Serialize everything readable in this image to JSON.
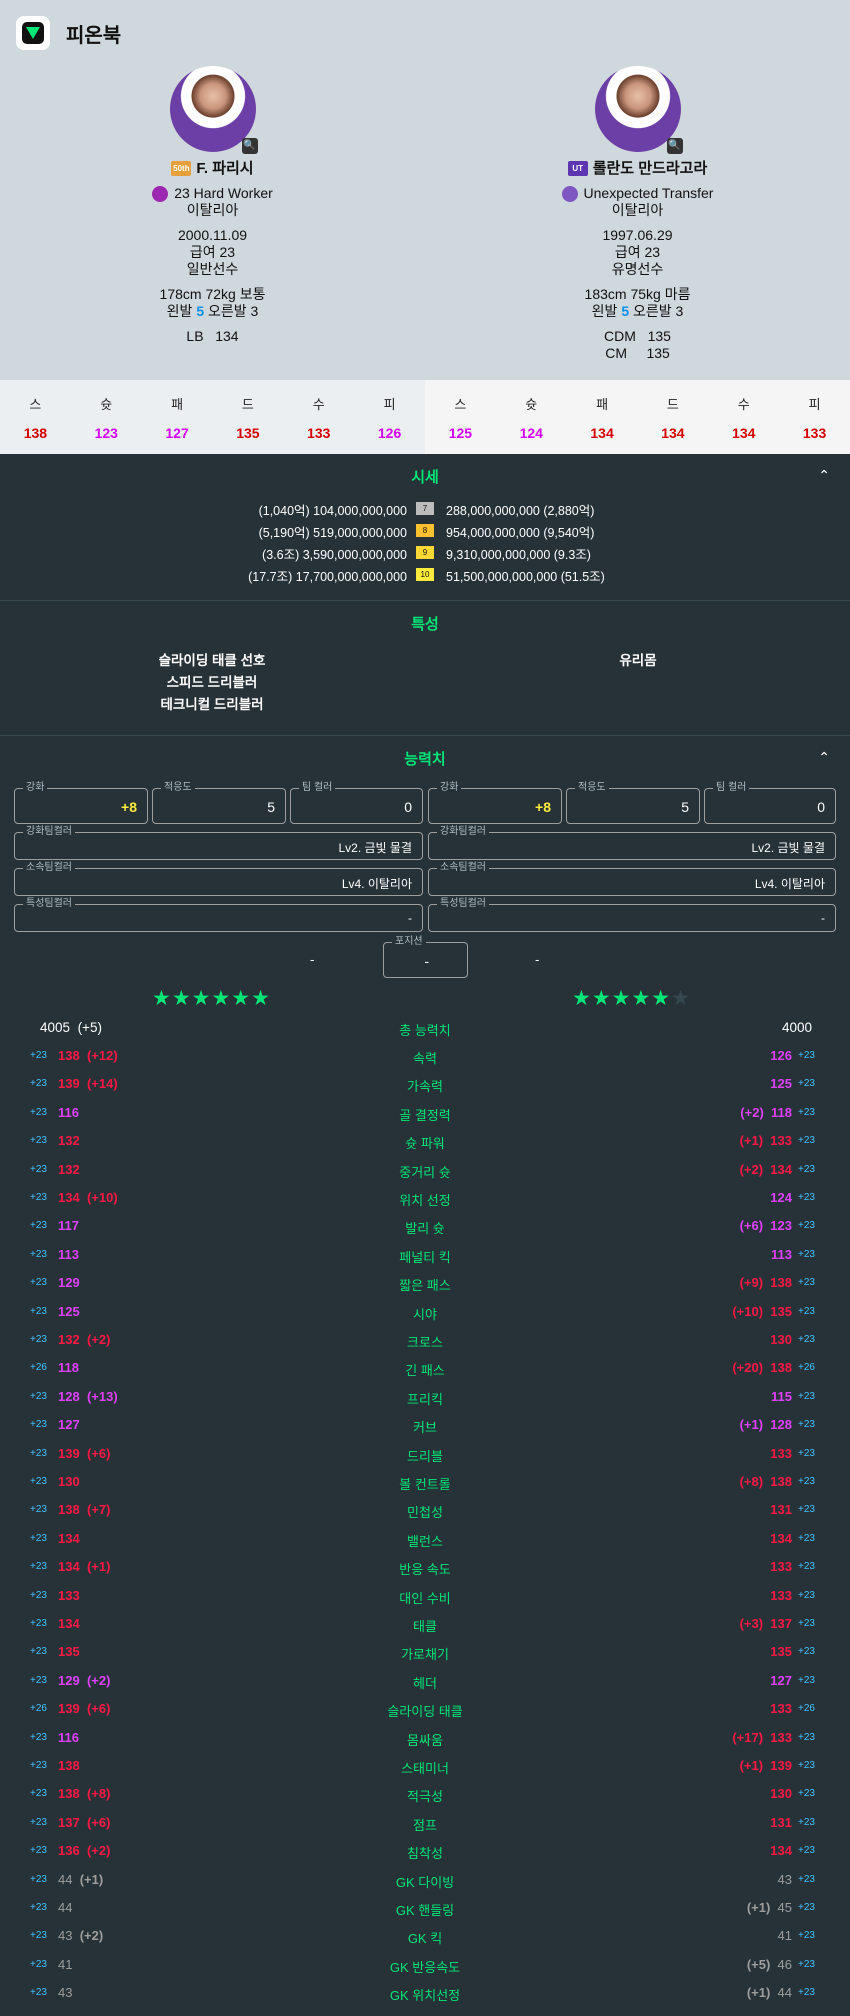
{
  "app": {
    "title": "피온북"
  },
  "players": [
    {
      "name": "F. 파리시",
      "season_badge": "50th",
      "season_color": "#e6a13c",
      "trait": "23 Hard Worker",
      "nation": "이탈리아",
      "birth": "2000.11.09",
      "salary": "급여 23",
      "type": "일반선수",
      "body": "178cm 72kg 보통",
      "foot_prefix": "왼발",
      "foot_left": "5",
      "foot_suffix": "오른발 3",
      "positions": [
        {
          "pos": "LB",
          "ovr": "134"
        }
      ],
      "summary": [
        {
          "label": "스",
          "value": "138"
        },
        {
          "label": "슛",
          "value": "123"
        },
        {
          "label": "패",
          "value": "127"
        },
        {
          "label": "드",
          "value": "135"
        },
        {
          "label": "수",
          "value": "133"
        },
        {
          "label": "피",
          "value": "126"
        }
      ]
    },
    {
      "name": "롤란도 만드라고라",
      "season_badge": "UT",
      "season_color": "#5e35b1",
      "trait": "Unexpected Transfer",
      "nation": "이탈리아",
      "birth": "1997.06.29",
      "salary": "급여 23",
      "type": "유명선수",
      "body": "183cm 75kg 마름",
      "foot_prefix": "왼발",
      "foot_left": "5",
      "foot_suffix": "오른발 3",
      "positions": [
        {
          "pos": "CDM",
          "ovr": "135"
        },
        {
          "pos": "CM",
          "ovr": "135"
        }
      ],
      "summary": [
        {
          "label": "스",
          "value": "125"
        },
        {
          "label": "슛",
          "value": "124"
        },
        {
          "label": "패",
          "value": "134"
        },
        {
          "label": "드",
          "value": "134"
        },
        {
          "label": "수",
          "value": "134"
        },
        {
          "label": "피",
          "value": "133"
        }
      ]
    }
  ],
  "colors": {
    "red": "#ff1744",
    "magenta": "#e040fb",
    "green": "#00e676",
    "blue": "#40c4ff",
    "gray": "#9e9e9e"
  },
  "price": {
    "title": "시세",
    "rows": [
      {
        "left": "(1,040억) 104,000,000,000",
        "level": "7",
        "right": "288,000,000,000 (2,880억)"
      },
      {
        "left": "(5,190억) 519,000,000,000",
        "level": "8",
        "right": "954,000,000,000 (9,540억)"
      },
      {
        "left": "(3.6조) 3,590,000,000,000",
        "level": "9",
        "right": "9,310,000,000,000 (9.3조)"
      },
      {
        "left": "(17.7조) 17,700,000,000,000",
        "level": "10",
        "right": "51,500,000,000,000 (51.5조)"
      }
    ]
  },
  "features": {
    "title": "특성",
    "left": [
      "슬라이딩 태클 선호",
      "스피드 드리블러",
      "테크니컬 드리블러"
    ],
    "right": [
      "유리몸"
    ]
  },
  "ability": {
    "title": "능력치",
    "fields": {
      "enhance_label": "강화",
      "adapt_label": "적응도",
      "teamcolor_label": "팀 컬러",
      "enhance_team_label": "강화팀컬러",
      "club_team_label": "소속팀컬러",
      "feature_team_label": "특성팀컬러",
      "position_label": "포지션",
      "position_value": "-"
    },
    "left": {
      "enhance": "+8",
      "adapt": "5",
      "teamcolor": "0",
      "enhance_team": "Lv2. 금빛 물결",
      "club_team": "Lv4. 이탈리아",
      "feature_team": "-",
      "side": "-"
    },
    "right": {
      "enhance": "+8",
      "adapt": "5",
      "teamcolor": "0",
      "enhance_team": "Lv2. 금빛 물결",
      "club_team": "Lv4. 이탈리아",
      "feature_team": "-",
      "side": "-"
    },
    "stars_left": "★★★★★★",
    "stars_right": "★★★★★",
    "stars_right_max": 6,
    "total": {
      "label": "총 능력치",
      "left": "4005",
      "left_diff": "(+5)",
      "right": "4000"
    },
    "stats": [
      {
        "name": "속력",
        "lb": "+23",
        "lv": "138",
        "lc": "red",
        "ld": "(+12)",
        "rv": "126",
        "rc": "magenta",
        "rd": "",
        "rb": "+23"
      },
      {
        "name": "가속력",
        "lb": "+23",
        "lv": "139",
        "lc": "red",
        "ld": "(+14)",
        "rv": "125",
        "rc": "magenta",
        "rd": "",
        "rb": "+23"
      },
      {
        "name": "골 결정력",
        "lb": "+23",
        "lv": "116",
        "lc": "magenta",
        "ld": "",
        "rv": "118",
        "rc": "magenta",
        "rd": "(+2)",
        "rb": "+23"
      },
      {
        "name": "슛 파워",
        "lb": "+23",
        "lv": "132",
        "lc": "red",
        "ld": "",
        "rv": "133",
        "rc": "red",
        "rd": "(+1)",
        "rb": "+23"
      },
      {
        "name": "중거리 슛",
        "lb": "+23",
        "lv": "132",
        "lc": "red",
        "ld": "",
        "rv": "134",
        "rc": "red",
        "rd": "(+2)",
        "rb": "+23"
      },
      {
        "name": "위치 선정",
        "lb": "+23",
        "lv": "134",
        "lc": "red",
        "ld": "(+10)",
        "rv": "124",
        "rc": "magenta",
        "rd": "",
        "rb": "+23"
      },
      {
        "name": "발리 슛",
        "lb": "+23",
        "lv": "117",
        "lc": "magenta",
        "ld": "",
        "rv": "123",
        "rc": "magenta",
        "rd": "(+6)",
        "rb": "+23"
      },
      {
        "name": "페널티 킥",
        "lb": "+23",
        "lv": "113",
        "lc": "magenta",
        "ld": "",
        "rv": "113",
        "rc": "magenta",
        "rd": "",
        "rb": "+23"
      },
      {
        "name": "짧은 패스",
        "lb": "+23",
        "lv": "129",
        "lc": "magenta",
        "ld": "",
        "rv": "138",
        "rc": "red",
        "rd": "(+9)",
        "rb": "+23"
      },
      {
        "name": "시야",
        "lb": "+23",
        "lv": "125",
        "lc": "magenta",
        "ld": "",
        "rv": "135",
        "rc": "red",
        "rd": "(+10)",
        "rb": "+23"
      },
      {
        "name": "크로스",
        "lb": "+23",
        "lv": "132",
        "lc": "red",
        "ld": "(+2)",
        "rv": "130",
        "rc": "red",
        "rd": "",
        "rb": "+23"
      },
      {
        "name": "긴 패스",
        "lb": "+26",
        "lv": "118",
        "lc": "magenta",
        "ld": "",
        "rv": "138",
        "rc": "red",
        "rd": "(+20)",
        "rb": "+26"
      },
      {
        "name": "프리킥",
        "lb": "+23",
        "lv": "128",
        "lc": "magenta",
        "ld": "(+13)",
        "rv": "115",
        "rc": "magenta",
        "rd": "",
        "rb": "+23"
      },
      {
        "name": "커브",
        "lb": "+23",
        "lv": "127",
        "lc": "magenta",
        "ld": "",
        "rv": "128",
        "rc": "magenta",
        "rd": "(+1)",
        "rb": "+23"
      },
      {
        "name": "드리블",
        "lb": "+23",
        "lv": "139",
        "lc": "red",
        "ld": "(+6)",
        "rv": "133",
        "rc": "red",
        "rd": "",
        "rb": "+23"
      },
      {
        "name": "볼 컨트롤",
        "lb": "+23",
        "lv": "130",
        "lc": "red",
        "ld": "",
        "rv": "138",
        "rc": "red",
        "rd": "(+8)",
        "rb": "+23"
      },
      {
        "name": "민첩성",
        "lb": "+23",
        "lv": "138",
        "lc": "red",
        "ld": "(+7)",
        "rv": "131",
        "rc": "red",
        "rd": "",
        "rb": "+23"
      },
      {
        "name": "밸런스",
        "lb": "+23",
        "lv": "134",
        "lc": "red",
        "ld": "",
        "rv": "134",
        "rc": "red",
        "rd": "",
        "rb": "+23"
      },
      {
        "name": "반응 속도",
        "lb": "+23",
        "lv": "134",
        "lc": "red",
        "ld": "(+1)",
        "rv": "133",
        "rc": "red",
        "rd": "",
        "rb": "+23"
      },
      {
        "name": "대인 수비",
        "lb": "+23",
        "lv": "133",
        "lc": "red",
        "ld": "",
        "rv": "133",
        "rc": "red",
        "rd": "",
        "rb": "+23"
      },
      {
        "name": "태클",
        "lb": "+23",
        "lv": "134",
        "lc": "red",
        "ld": "",
        "rv": "137",
        "rc": "red",
        "rd": "(+3)",
        "rb": "+23"
      },
      {
        "name": "가로채기",
        "lb": "+23",
        "lv": "135",
        "lc": "red",
        "ld": "",
        "rv": "135",
        "rc": "red",
        "rd": "",
        "rb": "+23"
      },
      {
        "name": "헤더",
        "lb": "+23",
        "lv": "129",
        "lc": "magenta",
        "ld": "(+2)",
        "rv": "127",
        "rc": "magenta",
        "rd": "",
        "rb": "+23"
      },
      {
        "name": "슬라이딩 태클",
        "lb": "+26",
        "lv": "139",
        "lc": "red",
        "ld": "(+6)",
        "rv": "133",
        "rc": "red",
        "rd": "",
        "rb": "+26"
      },
      {
        "name": "몸싸움",
        "lb": "+23",
        "lv": "116",
        "lc": "magenta",
        "ld": "",
        "rv": "133",
        "rc": "red",
        "rd": "(+17)",
        "rb": "+23"
      },
      {
        "name": "스태미너",
        "lb": "+23",
        "lv": "138",
        "lc": "red",
        "ld": "",
        "rv": "139",
        "rc": "red",
        "rd": "(+1)",
        "rb": "+23"
      },
      {
        "name": "적극성",
        "lb": "+23",
        "lv": "138",
        "lc": "red",
        "ld": "(+8)",
        "rv": "130",
        "rc": "red",
        "rd": "",
        "rb": "+23"
      },
      {
        "name": "점프",
        "lb": "+23",
        "lv": "137",
        "lc": "red",
        "ld": "(+6)",
        "rv": "131",
        "rc": "red",
        "rd": "",
        "rb": "+23"
      },
      {
        "name": "침착성",
        "lb": "+23",
        "lv": "136",
        "lc": "red",
        "ld": "(+2)",
        "rv": "134",
        "rc": "red",
        "rd": "",
        "rb": "+23"
      },
      {
        "name": "GK 다이빙",
        "lb": "+23",
        "lv": "44",
        "lc": "gray",
        "ld": "(+1)",
        "rv": "43",
        "rc": "gray",
        "rd": "",
        "rb": "+23"
      },
      {
        "name": "GK 핸들링",
        "lb": "+23",
        "lv": "44",
        "lc": "gray",
        "ld": "",
        "rv": "45",
        "rc": "gray",
        "rd": "(+1)",
        "rb": "+23"
      },
      {
        "name": "GK 킥",
        "lb": "+23",
        "lv": "43",
        "lc": "gray",
        "ld": "(+2)",
        "rv": "41",
        "rc": "gray",
        "rd": "",
        "rb": "+23"
      },
      {
        "name": "GK 반응속도",
        "lb": "+23",
        "lv": "41",
        "lc": "gray",
        "ld": "",
        "rv": "46",
        "rc": "gray",
        "rd": "(+5)",
        "rb": "+23"
      },
      {
        "name": "GK 위치선정",
        "lb": "+23",
        "lv": "43",
        "lc": "gray",
        "ld": "",
        "rv": "44",
        "rc": "gray",
        "rd": "(+1)",
        "rb": "+23"
      }
    ]
  }
}
